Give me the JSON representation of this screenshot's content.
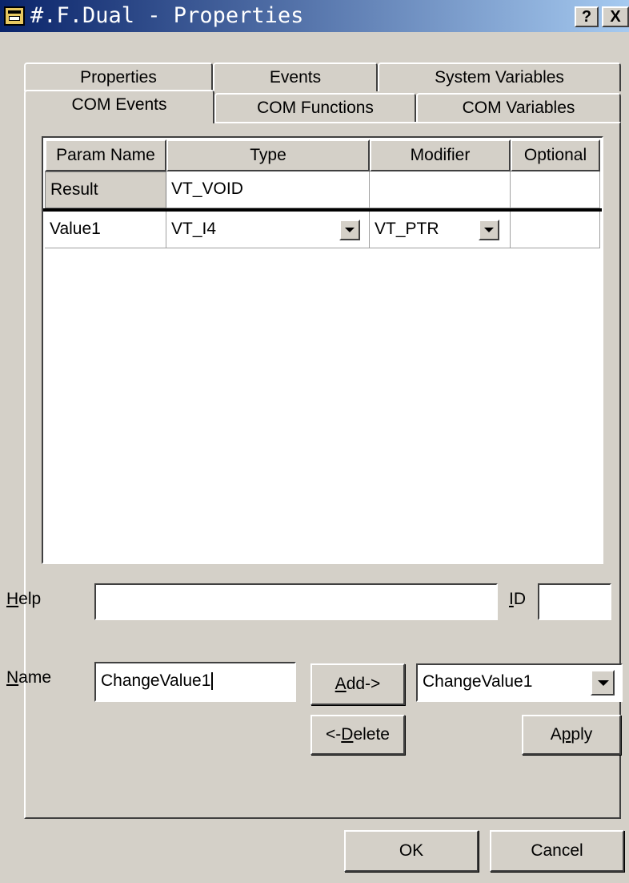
{
  "window": {
    "title": "#.F.Dual - Properties",
    "help_button": "?",
    "close_button": "X"
  },
  "tabs": {
    "row_back": [
      "Properties",
      "Events",
      "System Variables"
    ],
    "row_front": [
      "COM Events",
      "COM Functions",
      "COM Variables"
    ],
    "active": "COM Events"
  },
  "grid": {
    "columns": [
      "Param Name",
      "Type",
      "Modifier",
      "Optional"
    ],
    "rows": [
      {
        "name": "Result",
        "type": "VT_VOID",
        "modifier": "",
        "optional": ""
      },
      {
        "name": "Value1",
        "type": "VT_I4",
        "modifier": "VT_PTR",
        "optional": ""
      }
    ]
  },
  "form": {
    "help_label": "Help",
    "help_value": "",
    "id_label": "ID",
    "id_value": "",
    "name_label": "Name",
    "name_value": "ChangeValue1",
    "add_button": "Add->",
    "delete_button": "<-Delete",
    "combo_value": "ChangeValue1",
    "apply_button": "Apply"
  },
  "footer": {
    "ok_button": "OK",
    "cancel_button": "Cancel"
  }
}
